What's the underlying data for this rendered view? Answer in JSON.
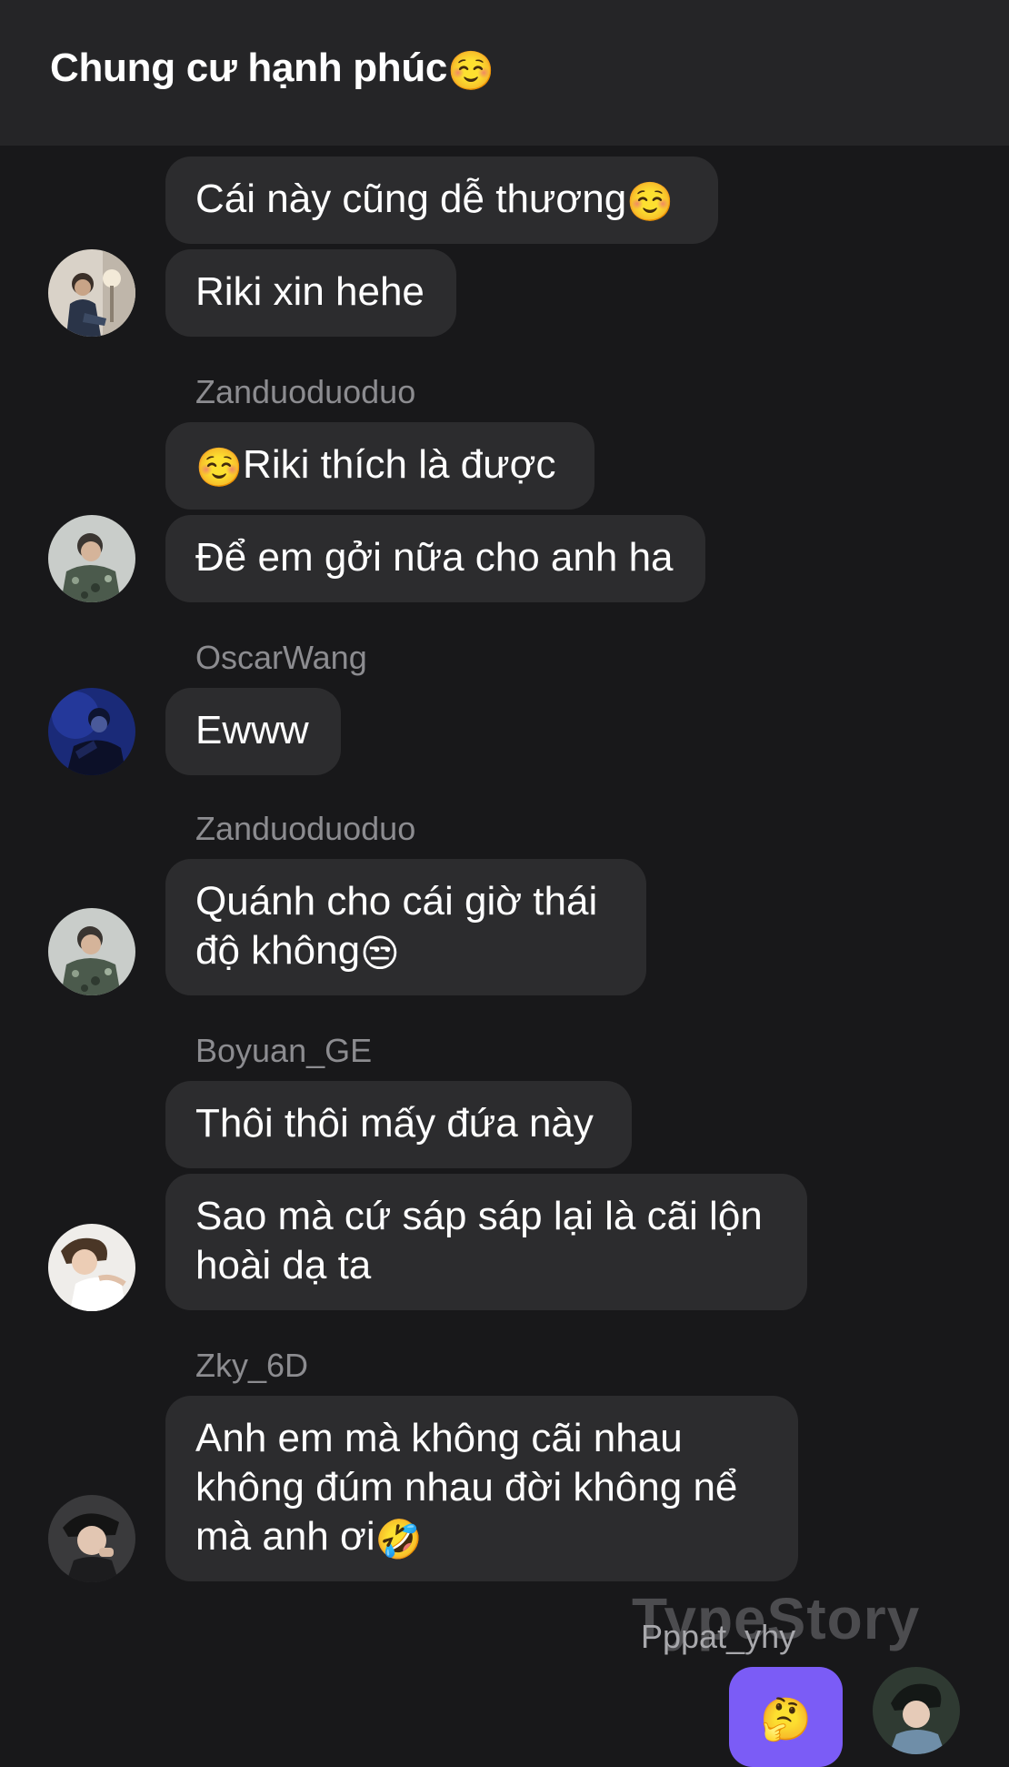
{
  "header": {
    "title": "Chung cư hạnh phúc",
    "title_emoji": "☺️"
  },
  "messages": {
    "m1": {
      "text": "Cái này cũng dễ thương",
      "emoji": "☺️"
    },
    "m2": {
      "text": "Riki xin hehe"
    },
    "m3": {
      "sender": "Zanduoduoduo",
      "emoji": "☺️",
      "text": "Riki thích là được"
    },
    "m4": {
      "text": "Để em gởi nữa cho anh ha"
    },
    "m5": {
      "sender": "OscarWang",
      "text": "Ewww"
    },
    "m6": {
      "sender": "Zanduoduoduo",
      "line1": "Quánh cho cái giờ thái",
      "line2": "độ không",
      "emoji": "😒"
    },
    "m7": {
      "sender": "Boyuan_GE",
      "text": "Thôi thôi mấy đứa này"
    },
    "m8": {
      "line1": "Sao mà cứ sáp sáp lại là cãi lộn",
      "line2": "hoài dạ ta"
    },
    "m9": {
      "sender": "Zky_6D",
      "line1": "Anh em mà không cãi nhau",
      "line2": "không đúm nhau đời không nể",
      "line3": "mà anh ơi",
      "emoji": "🤣"
    },
    "m10": {
      "sender": "Pppat_yhy",
      "emoji": "🤔"
    }
  },
  "watermark": "TypeStory",
  "colors": {
    "background": "#18181a",
    "header": "#252527",
    "bubble": "#2c2c2e",
    "own_bubble": "#7b5cf6",
    "sender_text": "#8c8c90"
  },
  "icons": [
    "avatar-riki",
    "avatar-zanduoduoduo",
    "avatar-oscarwang",
    "avatar-boyuan",
    "avatar-zky",
    "avatar-pppat"
  ]
}
